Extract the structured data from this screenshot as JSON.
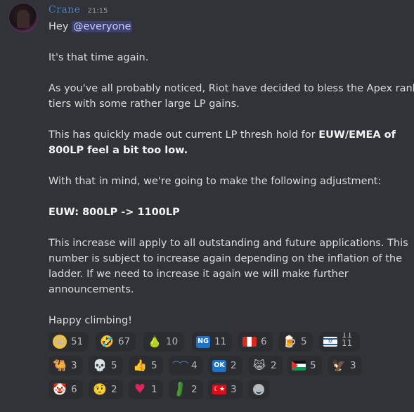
{
  "message": {
    "author": "Crane",
    "timestamp": "21:15",
    "greeting": "Hey",
    "mention": "@everyone",
    "lines": {
      "l1": "It's that time again.",
      "l2a": "As you've all probably noticed, Riot have decided to bless the Apex rank",
      "l2b": "tiers with some rather large LP gains.",
      "l3a": "This has quickly made out current LP thresh hold for ",
      "l3bold1": "EUW/EMEA of",
      "l3bold2": "800LP feel a bit too low.",
      "l4": "With that in mind, we're going to make the following adjustment:",
      "l5bold": "EUW: 800LP -> 1100LP",
      "l6a": "This increase will apply to all outstanding and future applications. This",
      "l6b": "number is subject to increase again depending on the inflation of the",
      "l6c": "ladder. If we need to increase it again we will make further",
      "l6d": "announcements.",
      "l7": "Happy climbing!"
    }
  },
  "reactions": [
    {
      "icon": "loudly-crying-face-icon",
      "count": "51"
    },
    {
      "icon": "rolling-on-floor-laughing-icon",
      "count": "67"
    },
    {
      "icon": "pear-icon",
      "count": "10"
    },
    {
      "icon": "ng-button-icon",
      "count": "11"
    },
    {
      "icon": "flag-peru-icon",
      "count": "6"
    },
    {
      "icon": "beer-mug-icon",
      "count": "5"
    },
    {
      "icon": "flag-israel-icon",
      "count": "11",
      "count_top": "11"
    },
    {
      "icon": "camel-icon",
      "count": "3"
    },
    {
      "icon": "skull-icon",
      "count": "5"
    },
    {
      "icon": "thumbs-up-icon",
      "count": "5"
    },
    {
      "icon": "eyelashes-icon",
      "count": "4"
    },
    {
      "icon": "ok-button-icon",
      "count": "2"
    },
    {
      "icon": "cat-tears-of-joy-icon",
      "count": "2"
    },
    {
      "icon": "flag-palestine-icon",
      "count": "5"
    },
    {
      "icon": "eagle-icon",
      "count": "3"
    },
    {
      "icon": "clown-face-icon",
      "count": "6"
    },
    {
      "icon": "face-with-raised-eyebrow-icon",
      "count": "2"
    },
    {
      "icon": "red-heart-icon",
      "count": "1"
    },
    {
      "icon": "cucumber-icon",
      "count": "2"
    },
    {
      "icon": "flag-turkey-icon",
      "count": "3"
    }
  ],
  "glyphs": {
    "ng": "NG",
    "ok": "OK",
    "pear": "🍐",
    "beer": "🍺",
    "camel": "🐫",
    "skull": "💀",
    "thumb": "👍",
    "lashes": "⌒⌒",
    "eagle": "🦅",
    "heart": "♥",
    "cucumber": "🥒",
    "turkey": "☾★",
    "israel": "✡",
    "face_sad": "😭",
    "face_rofl": "🤣",
    "face_cat": "😹",
    "face_raised": "🤨",
    "face_clown": "🤡"
  }
}
